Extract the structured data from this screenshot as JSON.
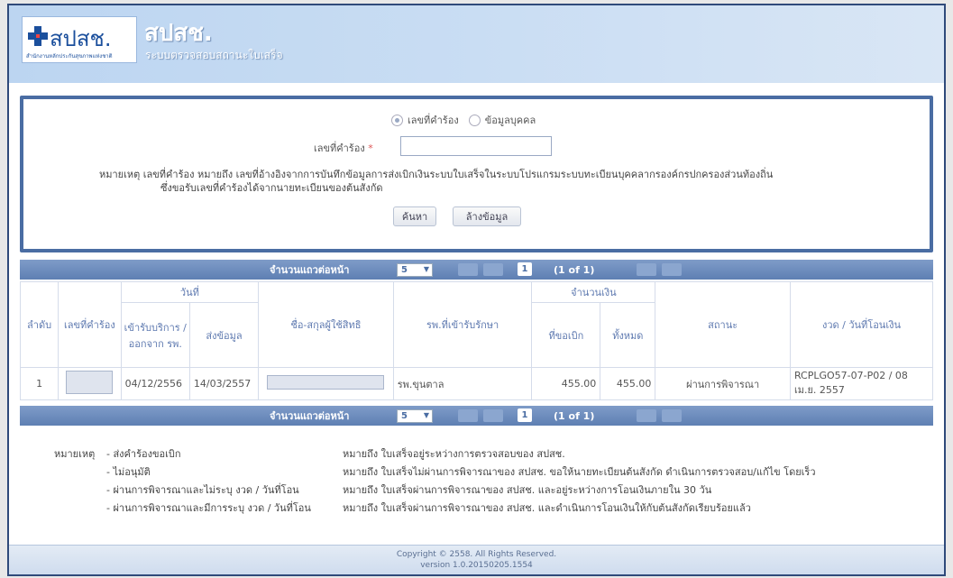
{
  "header": {
    "logo_text": "สปสช.",
    "logo_sub": "สำนักงานหลักประกันสุขภาพแห่งชาติ",
    "title": "สปสช.",
    "subtitle": "ระบบตรวจสอบสถานะใบเสร็จ",
    "brand_color": "#1b4f9c"
  },
  "search": {
    "radio_request_no": "เลขที่คำร้อง",
    "radio_personal": "ข้อมูลบุคคล",
    "field_label": "เลขที่คำร้อง",
    "required_mark": "*",
    "input_value": "",
    "note_line1": "หมายเหตุ  เลขที่คำร้อง หมายถึง เลขที่อ้างอิงจากการบันทึกข้อมูลการส่งเบิกเงินระบบใบเสร็จในระบบโปรแกรมระบบทะเบียนบุคคลากรองค์กรปกครองส่วนท้องถิ่น",
    "note_line2": "ซึ่งขอรับเลขที่คำร้องได้จากนายทะเบียนของต้นสังกัด",
    "search_button": "ค้นหา",
    "clear_button": "ล้างข้อมูล"
  },
  "pager": {
    "rows_label": "จำนวนแถวต่อหน้า",
    "rows_value": "5",
    "page": "1",
    "of_text": "(1 of 1)"
  },
  "table": {
    "h_no": "ลำดับ",
    "h_req": "เลขที่คำร้อง",
    "h_date": "วันที่",
    "h_date_in": "เข้ารับบริการ / ออกจาก รพ.",
    "h_date_sent": "ส่งข้อมูล",
    "h_name": "ชื่อ-สกุลผู้ใช้สิทธิ",
    "h_hosp": "รพ.ที่เข้ารับรักษา",
    "h_amount": "จำนวนเงิน",
    "h_claim": "ที่ขอเบิก",
    "h_total": "ทั้งหมด",
    "h_status": "สถานะ",
    "h_batch": "งวด / วันที่โอนเงิน",
    "rows": [
      {
        "no": "1",
        "date_in": "04/12/2556",
        "date_sent": "14/03/2557",
        "hospital": "รพ.ขุนตาล",
        "claim": "455.00",
        "total": "455.00",
        "status": "ผ่านการพิจารณา",
        "batch": "RCPLGO57-07-P02 / 08 เม.ย. 2557"
      }
    ]
  },
  "legend": {
    "title": "หมายเหตุ",
    "items": [
      {
        "key": "- ส่งคำร้องขอเบิก",
        "desc": "หมายถึง  ใบเสร็จอยู่ระหว่างการตรวจสอบของ สปสช."
      },
      {
        "key": "- ไม่อนุมัติ",
        "desc": "หมายถึง  ใบเสร็จไม่ผ่านการพิจารณาของ สปสช. ขอให้นายทะเบียนต้นสังกัด ดำเนินการตรวจสอบ/แก้ไข โดยเร็ว"
      },
      {
        "key": "- ผ่านการพิจารณาและไม่ระบุ งวด / วันที่โอน",
        "desc": "หมายถึง  ใบเสร็จผ่านการพิจารณาของ สปสช. และอยู่ระหว่างการโอนเงินภายใน 30 วัน"
      },
      {
        "key": "- ผ่านการพิจารณาและมีการระบุ งวด / วันที่โอน",
        "desc": "หมายถึง  ใบเสร็จผ่านการพิจารณาของ สปสช. และดำเนินการโอนเงินให้กับต้นสังกัดเรียบร้อยแล้ว"
      }
    ]
  },
  "footer": {
    "copyright": "Copyright © 2558. All Rights Reserved.",
    "version": "version 1.0.20150205.1554"
  }
}
